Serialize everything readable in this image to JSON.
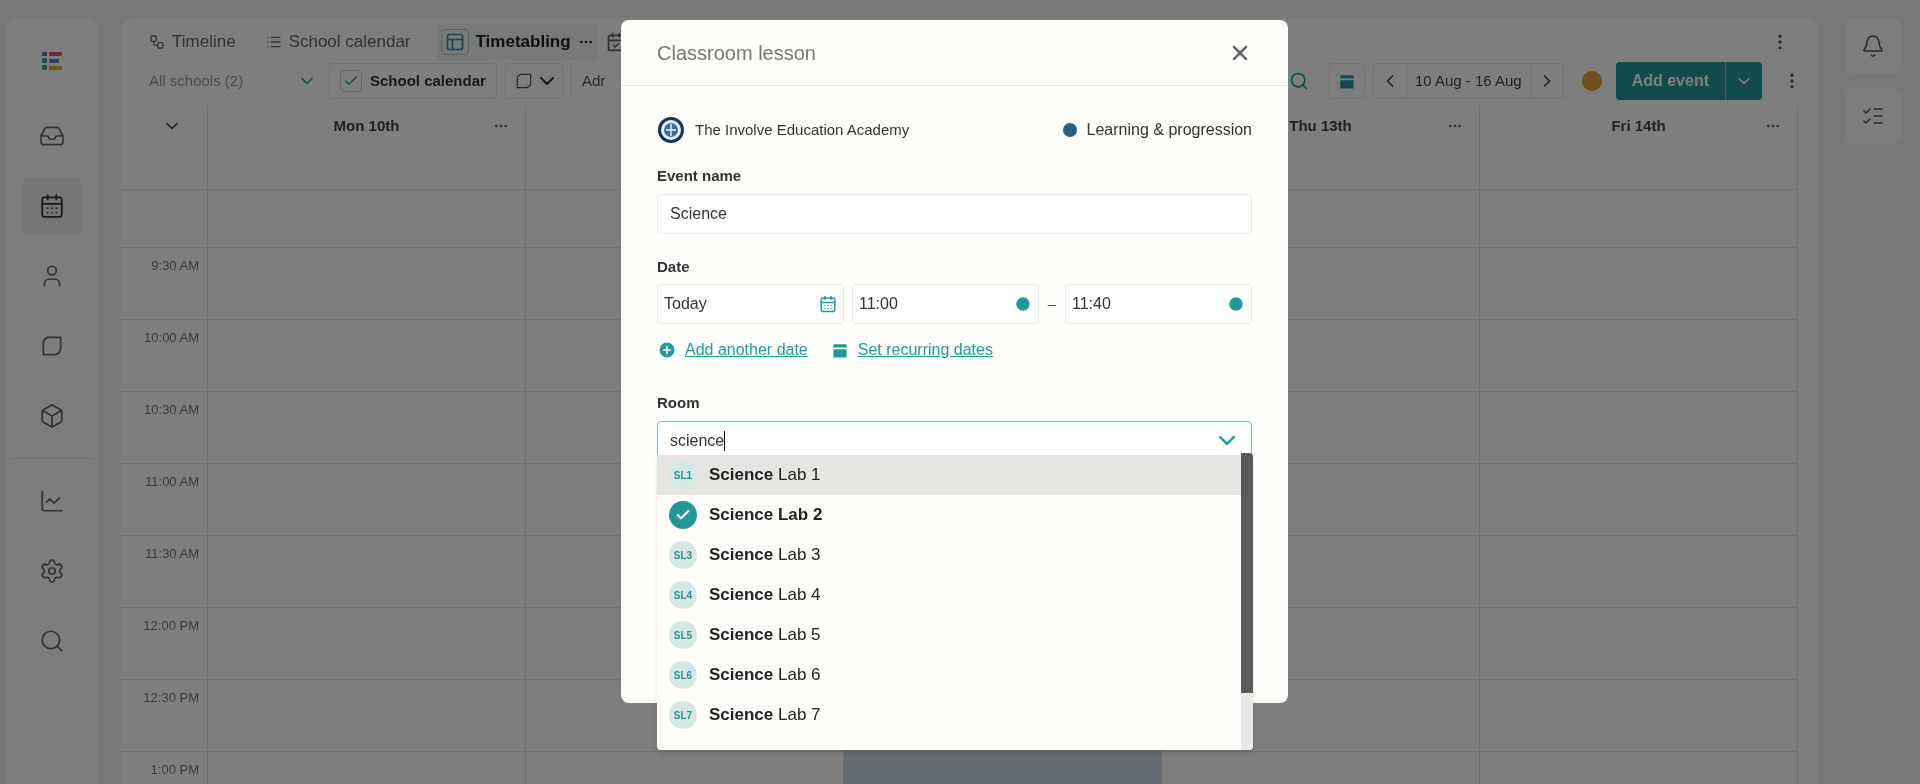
{
  "nav": [
    {
      "kind": "inbox",
      "selected": false
    },
    {
      "kind": "calendar",
      "selected": true
    },
    {
      "kind": "person",
      "selected": false
    },
    {
      "kind": "leaf",
      "selected": false
    },
    {
      "kind": "cube",
      "selected": false
    },
    {
      "kind": "chart",
      "selected": false
    },
    {
      "kind": "gear",
      "selected": false
    },
    {
      "kind": "search",
      "selected": false
    }
  ],
  "tabs": [
    {
      "kind": "timeline",
      "label": "Timeline",
      "selected": false
    },
    {
      "kind": "list",
      "label": "School calendar",
      "selected": false
    },
    {
      "kind": "timetable",
      "label": "Timetabling",
      "selected": true
    }
  ],
  "toolbar": {
    "school_filter": "All schools (2)",
    "calendar_toggle": {
      "label": "School calendar",
      "checked": true
    },
    "cut_button": "Adr",
    "date_range": "10 Aug - 16 Aug",
    "add_button": "Add event"
  },
  "day_columns": [
    {
      "label": "Mon 10th"
    },
    {},
    {},
    {
      "label": "Thu 13th"
    },
    {
      "label": "Fri 14th"
    }
  ],
  "time_labels": [
    "9:30 AM",
    "10:00 AM",
    "10:30 AM",
    "11:00 AM",
    "11:30 AM",
    "12:00 PM",
    "12:30 PM",
    "1:00 PM"
  ],
  "modal": {
    "title": "Classroom lesson",
    "organisation": "The Involve Education Academy",
    "category": {
      "label": "Learning & progression",
      "color": "#2b5f82"
    },
    "event_name": {
      "label": "Event name",
      "value": "Science"
    },
    "date": {
      "label": "Date",
      "day": "Today",
      "start": "11:00",
      "separator": "–",
      "end": "11:40"
    },
    "links": [
      {
        "kind": "add",
        "label": "Add another date"
      },
      {
        "kind": "recurring",
        "label": "Set recurring dates"
      }
    ],
    "room": {
      "label": "Room",
      "value": "science",
      "options": [
        {
          "badge": "SL1",
          "label": "**Science** Lab 1",
          "selected": false,
          "highlighted": true
        },
        {
          "label": "**Science** Lab 2",
          "selected": true,
          "highlighted": false
        },
        {
          "badge": "SL3",
          "label": "**Science** Lab 3",
          "selected": false,
          "highlighted": false
        },
        {
          "badge": "SL4",
          "label": "**Science** Lab 4",
          "selected": false,
          "highlighted": false
        },
        {
          "badge": "SL5",
          "label": "**Science** Lab 5",
          "selected": false,
          "highlighted": false
        },
        {
          "badge": "SL6",
          "label": "**Science** Lab 6",
          "selected": false,
          "highlighted": false
        },
        {
          "badge": "SL7",
          "label": "**Science** Lab 7",
          "selected": false,
          "highlighted": false
        }
      ]
    }
  }
}
